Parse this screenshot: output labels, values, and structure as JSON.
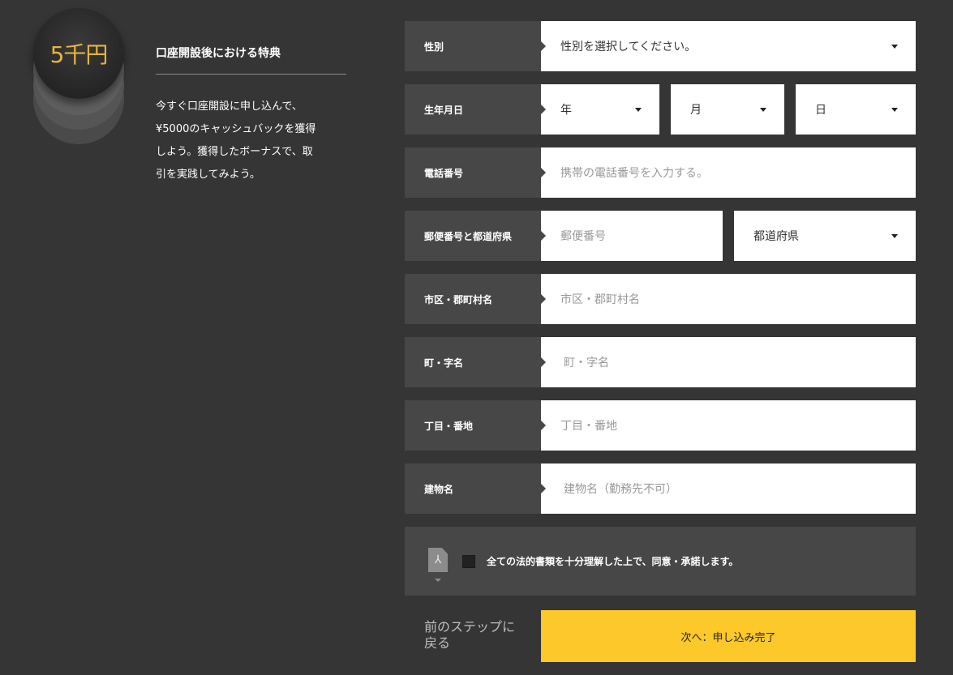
{
  "promo": {
    "coin_text": "5千円",
    "title": "口座開設後における特典",
    "body_lines": [
      "今すぐ口座開設に申し込んで、",
      "¥5000のキャッシュバックを獲得",
      "しよう。獲得したボーナスで、取",
      "引を実践してみよう。"
    ]
  },
  "form": {
    "gender": {
      "label": "性別",
      "placeholder": "性別を選択してください。"
    },
    "birthdate": {
      "label": "生年月日",
      "year": "年",
      "month": "月",
      "day": "日"
    },
    "phone": {
      "label": "電話番号",
      "placeholder": "携帯の電話番号を入力する。"
    },
    "postal": {
      "label": "郵便番号と都道府県",
      "postal_placeholder": "郵便番号",
      "prefecture": "都道府県"
    },
    "city": {
      "label": "市区・郡町村名",
      "placeholder": "市区・郡町村名"
    },
    "town": {
      "label": "町・字名",
      "placeholder": "町・字名"
    },
    "block": {
      "label": "丁目・番地",
      "placeholder": "丁目・番地"
    },
    "building": {
      "label": "建物名",
      "placeholder": "建物名（勤務先不可）"
    }
  },
  "agreement": {
    "text": "全ての法的書類を十分理解した上で、同意・承諾します。",
    "icon": "pdf-icon"
  },
  "nav": {
    "back_label": "前のステップに戻る",
    "next_label": "次へ：申し込み完了"
  },
  "colors": {
    "accent": "#fcc82a",
    "coin_text": "#e9b43c",
    "label_bg": "#474747",
    "page_bg": "#353535"
  }
}
